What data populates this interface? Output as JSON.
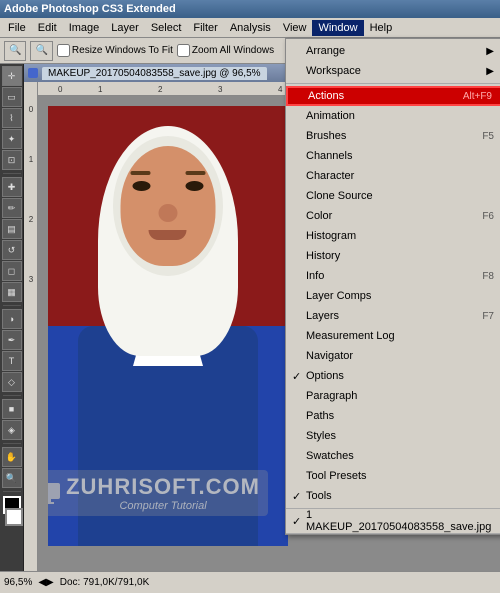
{
  "app": {
    "title": "Adobe Photoshop CS3 Extended",
    "document_tab": "MAKEUP_20170504083558_save.jpg @ 96,5%"
  },
  "menu_bar": {
    "items": [
      "File",
      "Edit",
      "Image",
      "Layer",
      "Select",
      "Filter",
      "Analysis",
      "View",
      "Window",
      "Help"
    ]
  },
  "menu_bar_active": "Window",
  "toolbar": {
    "zoom_label": "Resize Windows To Fit",
    "zoom_all_label": "Zoom All Windows"
  },
  "window_menu": {
    "sections": [
      {
        "items": [
          {
            "label": "Arrange",
            "shortcut": "",
            "arrow": true,
            "check": false
          },
          {
            "label": "Workspace",
            "shortcut": "",
            "arrow": true,
            "check": false
          }
        ]
      },
      {
        "items": [
          {
            "label": "Actions",
            "shortcut": "Alt+F9",
            "arrow": false,
            "check": false,
            "highlighted": true
          },
          {
            "label": "Animation",
            "shortcut": "",
            "arrow": false,
            "check": false
          },
          {
            "label": "Brushes",
            "shortcut": "F5",
            "arrow": false,
            "check": false
          },
          {
            "label": "Channels",
            "shortcut": "",
            "arrow": false,
            "check": false
          },
          {
            "label": "Character",
            "shortcut": "",
            "arrow": false,
            "check": false
          },
          {
            "label": "Clone Source",
            "shortcut": "",
            "arrow": false,
            "check": false
          },
          {
            "label": "Color",
            "shortcut": "F6",
            "arrow": false,
            "check": false
          },
          {
            "label": "Histogram",
            "shortcut": "",
            "arrow": false,
            "check": false
          },
          {
            "label": "History",
            "shortcut": "",
            "arrow": false,
            "check": false
          },
          {
            "label": "Info",
            "shortcut": "F8",
            "arrow": false,
            "check": false
          },
          {
            "label": "Layer Comps",
            "shortcut": "",
            "arrow": false,
            "check": false
          },
          {
            "label": "Layers",
            "shortcut": "F7",
            "arrow": false,
            "check": false
          },
          {
            "label": "Measurement Log",
            "shortcut": "",
            "arrow": false,
            "check": false
          },
          {
            "label": "Navigator",
            "shortcut": "",
            "arrow": false,
            "check": false
          },
          {
            "label": "Options",
            "shortcut": "",
            "arrow": false,
            "check": true
          },
          {
            "label": "Paragraph",
            "shortcut": "",
            "arrow": false,
            "check": false
          },
          {
            "label": "Paths",
            "shortcut": "",
            "arrow": false,
            "check": false
          },
          {
            "label": "Styles",
            "shortcut": "",
            "arrow": false,
            "check": false
          },
          {
            "label": "Swatches",
            "shortcut": "",
            "arrow": false,
            "check": false
          },
          {
            "label": "Tool Presets",
            "shortcut": "",
            "arrow": false,
            "check": false
          },
          {
            "label": "Tools",
            "shortcut": "",
            "arrow": false,
            "check": true
          }
        ]
      },
      {
        "items": [
          {
            "label": "✓ 1 MAKEUP_20170504083558_save.jpg",
            "shortcut": "",
            "arrow": false,
            "check": false
          }
        ]
      }
    ]
  },
  "tools": [
    "M",
    "L",
    "C",
    "B",
    "E",
    "G",
    "D",
    "T",
    "P",
    "H",
    "Z"
  ],
  "status_bar": {
    "zoom": "96,5%",
    "doc_size": "Doc: 791,0K/791,0K"
  },
  "watermark": {
    "line1": "ZUHRISOFT.COM",
    "line2": "Computer Tutorial"
  }
}
